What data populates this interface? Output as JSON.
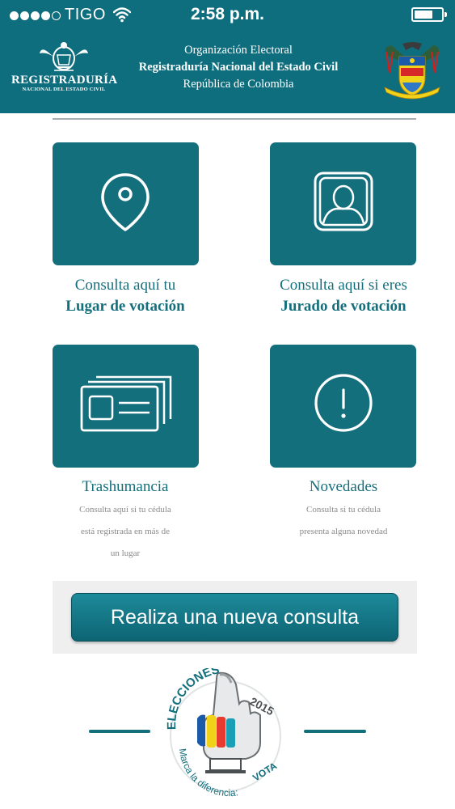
{
  "status_bar": {
    "carrier": "TIGO",
    "time": "2:58 p.m.",
    "signal_icon": "signal-dots-icon",
    "wifi_icon": "wifi-icon",
    "battery_icon": "battery-icon"
  },
  "header": {
    "logo_name": "REGISTRADURÍA",
    "logo_sub": "NACIONAL DEL ESTADO CIVIL",
    "org_line1": "Organización Electoral",
    "org_line2": "Registraduría Nacional del Estado Civil",
    "org_line3": "República de Colombia",
    "coat_icon": "coat-of-arms-icon"
  },
  "tiles": [
    {
      "line1": "Consulta aquí tu",
      "line2": "Lugar de votación",
      "icon": "location-pin-icon"
    },
    {
      "line1": "Consulta aquí si eres",
      "line2": "Jurado de votación",
      "icon": "person-portrait-icon"
    },
    {
      "title": "Trashumancia",
      "desc": [
        "Consulta aquí si tu cédula",
        "está registrada en más de",
        "un lugar"
      ],
      "icon": "id-cards-icon"
    },
    {
      "title": "Novedades",
      "desc": [
        "Consulta si tu cédula",
        "presenta alguna novedad"
      ],
      "icon": "exclamation-circle-icon"
    }
  ],
  "new_query_button": "Realiza una nueva consulta",
  "election_badge": {
    "top_text": "ELECCIONES",
    "year": "2015",
    "slogan_a": "Marca la diferencia:",
    "slogan_b": "VOTA",
    "icon": "elecciones-2015-logo"
  },
  "colors": {
    "primary": "#0f6e7e",
    "tile": "#146f7d",
    "panel": "#efefef",
    "desc_text": "#8a8a8a"
  }
}
